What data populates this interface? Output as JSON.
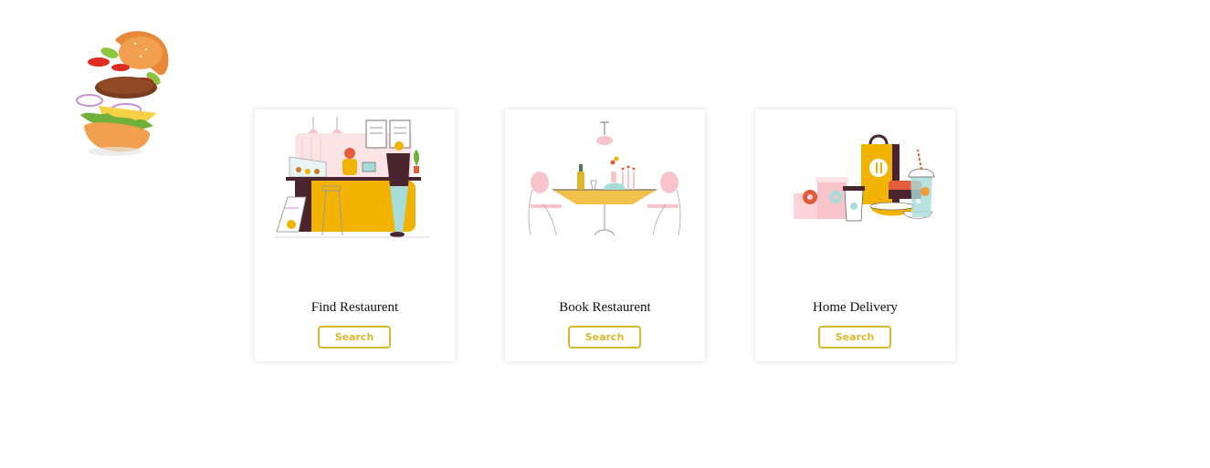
{
  "logo": {
    "icon": "burger-logo-icon"
  },
  "cards": [
    {
      "title": "Find Restaurent",
      "button_label": "Search",
      "illustration": "restaurant-counter-icon"
    },
    {
      "title": "Book Restaurent",
      "button_label": "Search",
      "illustration": "dining-table-icon"
    },
    {
      "title": "Home Delivery",
      "button_label": "Search",
      "illustration": "delivery-bag-icon"
    }
  ],
  "colors": {
    "accent": "#d8b92d",
    "yellow": "#f2b300",
    "pink": "#f7c4cc",
    "teal": "#a8dcd9",
    "dark": "#4a2530"
  }
}
